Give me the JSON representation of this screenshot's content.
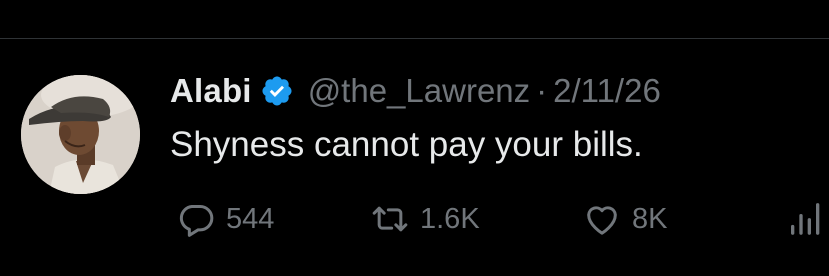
{
  "tweet": {
    "author_name": "Alabi",
    "handle": "@the_Lawrenz",
    "separator": "·",
    "date": "2/11/26",
    "text": "Shyness cannot pay your bills.",
    "verified_icon": "verified-badge-icon",
    "verified_color": "#1d9bf0"
  },
  "actions": {
    "reply": {
      "icon": "reply-icon",
      "count": "544"
    },
    "repost": {
      "icon": "repost-icon",
      "count": "1.6K"
    },
    "like": {
      "icon": "heart-icon",
      "count": "8K"
    },
    "views": {
      "icon": "views-chart-icon"
    }
  },
  "colors": {
    "background": "#000000",
    "primary_text": "#e7e9ea",
    "secondary_text": "#71767b",
    "divider": "#2f3336"
  }
}
